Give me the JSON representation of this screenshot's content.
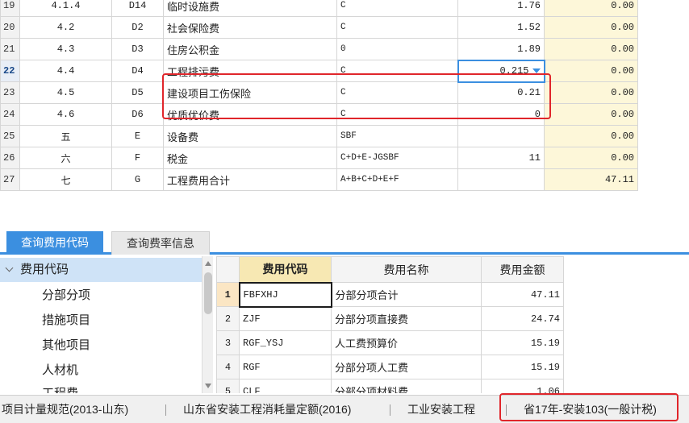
{
  "fee_table": {
    "rows": [
      {
        "rn": "19",
        "seq": "4.1.4",
        "code": "D14",
        "name": "临时设施费",
        "base": "C",
        "rate": "1.76",
        "amount": "0.00"
      },
      {
        "rn": "20",
        "seq": "4.2",
        "code": "D2",
        "name": "社会保险费",
        "base": "C",
        "rate": "1.52",
        "amount": "0.00"
      },
      {
        "rn": "21",
        "seq": "4.3",
        "code": "D3",
        "name": "住房公积金",
        "base": "0",
        "rate": "1.89",
        "amount": "0.00"
      },
      {
        "rn": "22",
        "seq": "4.4",
        "code": "D4",
        "name": "工程排污费",
        "base": "C",
        "rate": "0.215",
        "amount": "0.00"
      },
      {
        "rn": "23",
        "seq": "4.5",
        "code": "D5",
        "name": "建设项目工伤保险",
        "base": "C",
        "rate": "0.21",
        "amount": "0.00"
      },
      {
        "rn": "24",
        "seq": "4.6",
        "code": "D6",
        "name": "优质优价费",
        "base": "C",
        "rate": "0",
        "amount": "0.00"
      },
      {
        "rn": "25",
        "seq": "五",
        "code": "E",
        "name": "设备费",
        "base": "SBF",
        "rate": "",
        "amount": "0.00"
      },
      {
        "rn": "26",
        "seq": "六",
        "code": "F",
        "name": "税金",
        "base": "C+D+E-JGSBF",
        "rate": "11",
        "amount": "0.00"
      },
      {
        "rn": "27",
        "seq": "七",
        "code": "G",
        "name": "工程费用合计",
        "base": "A+B+C+D+E+F",
        "rate": "",
        "amount": "47.11"
      }
    ]
  },
  "tabs": {
    "query_codes": "查询费用代码",
    "query_rates": "查询费率信息"
  },
  "tree": {
    "root": "费用代码",
    "items": [
      "分部分项",
      "措施项目",
      "其他项目",
      "人材机",
      "工程费"
    ]
  },
  "code_table": {
    "headers": {
      "code": "费用代码",
      "name": "费用名称",
      "amount": "费用金额"
    },
    "rows": [
      {
        "rn": "1",
        "code": "FBFXHJ",
        "name": "分部分项合计",
        "amount": "47.11"
      },
      {
        "rn": "2",
        "code": "ZJF",
        "name": "分部分项直接费",
        "amount": "24.74"
      },
      {
        "rn": "3",
        "code": "RGF_YSJ",
        "name": "人工费预算价",
        "amount": "15.19"
      },
      {
        "rn": "4",
        "code": "RGF",
        "name": "分部分项人工费",
        "amount": "15.19"
      },
      {
        "rn": "5",
        "code": "CLF",
        "name": "分部分项材料费",
        "amount": "1.06"
      }
    ]
  },
  "status_bar": {
    "spec": "项目计量规范(2013-山东)",
    "quota": "山东省安装工程消耗量定额(2016)",
    "type": "工业安装工程",
    "rate_std": "省17年-安装103(一般计税)"
  },
  "colors": {
    "highlight_box": "#e0262b",
    "accent": "#3b8fe0",
    "amount_bg": "#fdf7d9"
  }
}
